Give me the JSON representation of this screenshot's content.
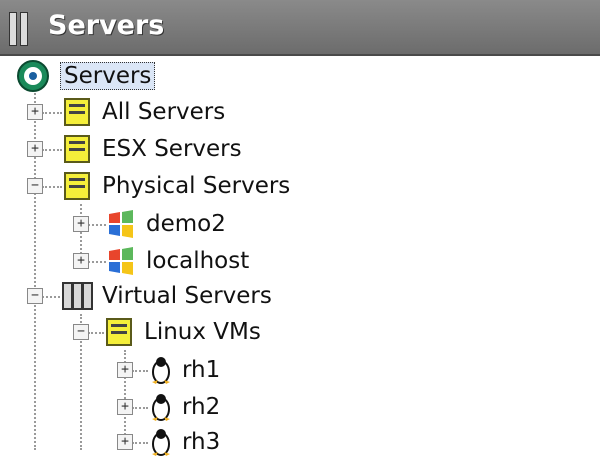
{
  "panel": {
    "title": "Servers"
  },
  "tree": {
    "root": {
      "label": "Servers",
      "icon": "servers-root-icon"
    },
    "all_servers": {
      "label": "All Servers",
      "expander": "+"
    },
    "esx_servers": {
      "label": "ESX Servers",
      "expander": "+"
    },
    "physical_servers": {
      "label": "Physical Servers",
      "expander": "−",
      "children": [
        {
          "label": "demo2",
          "expander": "+"
        },
        {
          "label": "localhost",
          "expander": "+"
        }
      ]
    },
    "virtual_servers": {
      "label": "Virtual Servers",
      "expander": "−",
      "linux_vms": {
        "label": "Linux VMs",
        "expander": "−",
        "children": [
          {
            "label": "rh1",
            "expander": "+"
          },
          {
            "label": "rh2",
            "expander": "+"
          },
          {
            "label": "rh3",
            "expander": "+"
          }
        ]
      }
    }
  },
  "colors": {
    "titlebar": "#7a7a7a",
    "selection": "#dbe6f6",
    "group": "#f5ef3a"
  }
}
